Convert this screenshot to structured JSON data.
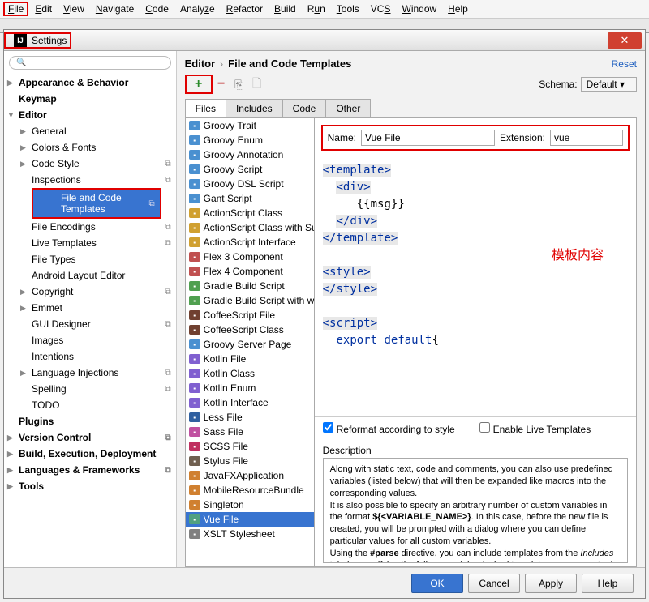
{
  "menubar": [
    "File",
    "Edit",
    "View",
    "Navigate",
    "Code",
    "Analyze",
    "Refactor",
    "Build",
    "Run",
    "Tools",
    "VCS",
    "Window",
    "Help"
  ],
  "dialog": {
    "title": "Settings"
  },
  "tree": {
    "items": [
      {
        "label": "Appearance & Behavior",
        "bold": true,
        "arrow": "▶"
      },
      {
        "label": "Keymap",
        "bold": true
      },
      {
        "label": "Editor",
        "bold": true,
        "arrow": "▼"
      },
      {
        "label": "General",
        "sub": true,
        "arrow": "▶"
      },
      {
        "label": "Colors & Fonts",
        "sub": true,
        "arrow": "▶"
      },
      {
        "label": "Code Style",
        "sub": true,
        "arrow": "▶",
        "copy": true
      },
      {
        "label": "Inspections",
        "sub": true,
        "copy": true
      },
      {
        "label": "File and Code Templates",
        "sub": true,
        "selected": true,
        "highlight": true,
        "copy": true
      },
      {
        "label": "File Encodings",
        "sub": true,
        "copy": true
      },
      {
        "label": "Live Templates",
        "sub": true,
        "copy": true
      },
      {
        "label": "File Types",
        "sub": true
      },
      {
        "label": "Android Layout Editor",
        "sub": true
      },
      {
        "label": "Copyright",
        "sub": true,
        "arrow": "▶",
        "copy": true
      },
      {
        "label": "Emmet",
        "sub": true,
        "arrow": "▶"
      },
      {
        "label": "GUI Designer",
        "sub": true,
        "copy": true
      },
      {
        "label": "Images",
        "sub": true
      },
      {
        "label": "Intentions",
        "sub": true
      },
      {
        "label": "Language Injections",
        "sub": true,
        "arrow": "▶",
        "copy": true
      },
      {
        "label": "Spelling",
        "sub": true,
        "copy": true
      },
      {
        "label": "TODO",
        "sub": true
      },
      {
        "label": "Plugins",
        "bold": true
      },
      {
        "label": "Version Control",
        "bold": true,
        "arrow": "▶",
        "copy": true
      },
      {
        "label": "Build, Execution, Deployment",
        "bold": true,
        "arrow": "▶"
      },
      {
        "label": "Languages & Frameworks",
        "bold": true,
        "arrow": "▶",
        "copy": true
      },
      {
        "label": "Tools",
        "bold": true,
        "arrow": "▶"
      }
    ]
  },
  "breadcrumb": {
    "a": "Editor",
    "b": "File and Code Templates",
    "reset": "Reset"
  },
  "schema": {
    "label": "Schema:",
    "value": "Default"
  },
  "tabs": [
    "Files",
    "Includes",
    "Code",
    "Other"
  ],
  "templates": [
    {
      "label": "Groovy Trait",
      "ic": "ic-g"
    },
    {
      "label": "Groovy Enum",
      "ic": "ic-g"
    },
    {
      "label": "Groovy Annotation",
      "ic": "ic-g"
    },
    {
      "label": "Groovy Script",
      "ic": "ic-g"
    },
    {
      "label": "Groovy DSL Script",
      "ic": "ic-g"
    },
    {
      "label": "Gant Script",
      "ic": "ic-g"
    },
    {
      "label": "ActionScript Class",
      "ic": "ic-as"
    },
    {
      "label": "ActionScript Class with Supers",
      "ic": "ic-as"
    },
    {
      "label": "ActionScript Interface",
      "ic": "ic-as"
    },
    {
      "label": "Flex 3 Component",
      "ic": "ic-f"
    },
    {
      "label": "Flex 4 Component",
      "ic": "ic-f"
    },
    {
      "label": "Gradle Build Script",
      "ic": "ic-gr"
    },
    {
      "label": "Gradle Build Script with wrapper",
      "ic": "ic-gr"
    },
    {
      "label": "CoffeeScript File",
      "ic": "ic-cf"
    },
    {
      "label": "CoffeeScript Class",
      "ic": "ic-cf"
    },
    {
      "label": "Groovy Server Page",
      "ic": "ic-g"
    },
    {
      "label": "Kotlin File",
      "ic": "ic-k"
    },
    {
      "label": "Kotlin Class",
      "ic": "ic-k"
    },
    {
      "label": "Kotlin Enum",
      "ic": "ic-k"
    },
    {
      "label": "Kotlin Interface",
      "ic": "ic-k"
    },
    {
      "label": "Less File",
      "ic": "ic-l"
    },
    {
      "label": "Sass File",
      "ic": "ic-s"
    },
    {
      "label": "SCSS File",
      "ic": "ic-sc"
    },
    {
      "label": "Stylus File",
      "ic": "ic-st"
    },
    {
      "label": "JavaFXApplication",
      "ic": "ic-j"
    },
    {
      "label": "MobileResourceBundle",
      "ic": "ic-j"
    },
    {
      "label": "Singleton",
      "ic": "ic-j"
    },
    {
      "label": "Vue File",
      "ic": "ic-v",
      "selected": true
    },
    {
      "label": "XSLT Stylesheet",
      "ic": "ic-x"
    }
  ],
  "detail": {
    "name_label": "Name:",
    "name_value": "Vue File",
    "ext_label": "Extension:",
    "ext_value": "vue",
    "annotation": "模板内容",
    "check1": "Reformat according to style",
    "check2": "Enable Live Templates",
    "desc_label": "Description",
    "desc": "Along with static text, code and comments, you can also use predefined variables (listed below) that will then be expanded like macros into the corresponding values.\nIt is also possible to specify an arbitrary number of custom variables in the format ${<VARIABLE_NAME>}. In this case, before the new file is created, you will be prompted with a dialog where you can define particular values for all custom variables.\nUsing the #parse directive, you can include templates from the Includes tab, by specifying the full name of the desired template as a parameter in quotation marks. For example:"
  },
  "buttons": {
    "ok": "OK",
    "cancel": "Cancel",
    "apply": "Apply",
    "help": "Help"
  }
}
